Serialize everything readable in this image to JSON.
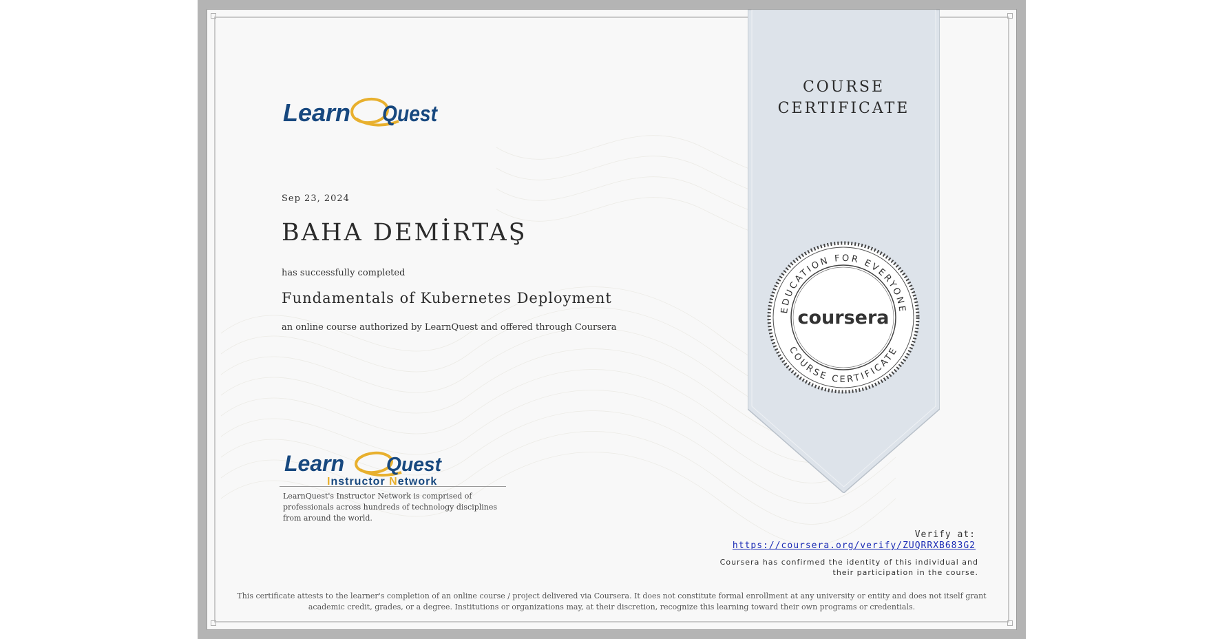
{
  "ribbon": {
    "line1": "COURSE",
    "line2": "CERTIFICATE"
  },
  "seal": {
    "top_text": "EDUCATION FOR EVERYONE",
    "bottom_text": "COURSE CERTIFICATE",
    "brand": "coursera"
  },
  "logo_top": {
    "text_learn": "Learn",
    "text_quest": "Quest"
  },
  "logo_bottom": {
    "text_learn": "Learn",
    "text_quest": "Quest",
    "subtitle_i": "I",
    "subtitle_nstructor": "nstructor ",
    "subtitle_n": "N",
    "subtitle_etwork": "etwork"
  },
  "certificate": {
    "date": "Sep 23, 2024",
    "recipient": "BAHA DEMİRTAŞ",
    "completed_text": "has successfully completed",
    "course_title": "Fundamentals of Kubernetes Deployment",
    "authorized_text": "an online course authorized by LearnQuest and offered through Coursera"
  },
  "signature": {
    "description": "LearnQuest's Instructor Network is comprised of professionals across hundreds of technology disciplines from around the world."
  },
  "verify": {
    "label": "Verify at:",
    "url": "https://coursera.org/verify/ZUQRRXB683G2",
    "confirmed": "Coursera has confirmed the identity of this individual and their participation in the course."
  },
  "footer": {
    "text": "This certificate attests to the learner's completion of an online course / project delivered via Coursera. It does not constitute formal enrollment at any university or entity and does not itself grant academic credit, grades, or a degree. Institutions or organizations may, at their discretion, recognize this learning toward their own programs or credentials."
  },
  "colors": {
    "learnquest_blue": "#17487f",
    "learnquest_gold": "#e8b02e",
    "ribbon_fill": "#dde3ea",
    "link": "#1a2bb5"
  }
}
